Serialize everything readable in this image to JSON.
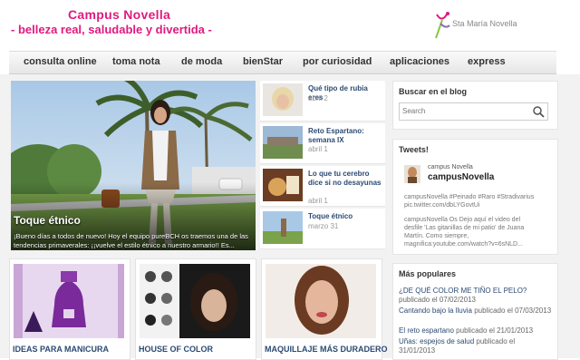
{
  "header": {
    "title": "Campus Novella",
    "tagline": "- belleza real, saludable y divertida -",
    "logo_text": "Sta María Novella"
  },
  "nav": {
    "items": [
      "consulta online",
      "toma nota",
      "de moda",
      "bienStar",
      "por curiosidad",
      "aplicaciones",
      "express"
    ]
  },
  "featured": {
    "title": "Toque étnico",
    "description": "¡Bueno días a todos de nuevo! Hoy el equipo pureBCH os traemos una de las tendencias primaverales: ¡¡vuelve el estilo étnico a nuestro armario!! Es..."
  },
  "side_posts": [
    {
      "title": "Qué tipo de rubia eres",
      "date": "abril 2"
    },
    {
      "title": "Reto Espartano: semana IX",
      "date": "abril 1"
    },
    {
      "title": "Lo que tu cerebro dice si no desayunas",
      "date": "abril 1"
    },
    {
      "title": "Toque étnico",
      "date": "marzo 31"
    }
  ],
  "cards": [
    {
      "title": "IDEAS PARA MANICURA"
    },
    {
      "title": "HOUSE OF COLOR"
    },
    {
      "title": "MAQUILLAJE MÁS DURADERO"
    }
  ],
  "search": {
    "title": "Buscar en el blog",
    "placeholder": "Search"
  },
  "tweets": {
    "title": "Tweets!",
    "name": "campus Novella",
    "handle": "campusNovella",
    "tweet1": "campusNovella #Peinado #Raro #Stradivarius pic.twitter.com/dbLYGovtUi",
    "tweet2_line1": "campusNovella Os Dejo aquí el video del",
    "tweet2_line2": "desfile 'Las gitanillas de mi patio' de Juana",
    "tweet2_line3": "Martín. Como siempre,",
    "tweet2_line4": "magnifica:youtube.com/watch?v=6sNLD..."
  },
  "popular": {
    "title": "Más populares",
    "items": [
      {
        "link": "¿DE QUÉ COLOR ME TIÑO EL PELO?",
        "meta": "publicado el 07/02/2013"
      },
      {
        "link": "Cantando bajo la lluvia",
        "meta": "publicado el 07/03/2013"
      },
      {
        "link": "El reto espartano",
        "meta": "publicado el 21/01/2013"
      },
      {
        "link": "Uñas: espejos de salud",
        "meta": "publicado el 31/01/2013"
      }
    ]
  },
  "colors": {
    "brand_pink": "#e01a7f",
    "link_blue": "#2c4a73"
  }
}
